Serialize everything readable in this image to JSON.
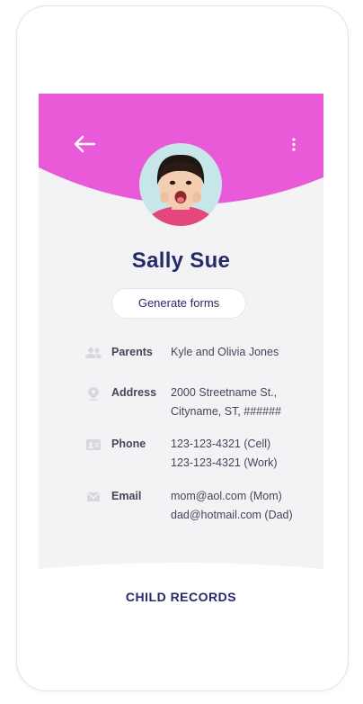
{
  "colors": {
    "accent": "#e95ad8",
    "navy": "#262a68",
    "background": "#f3f3f6",
    "icon": "#d7d8de"
  },
  "header": {
    "back_icon": "arrow-left-icon",
    "menu_icon": "more-vertical-icon"
  },
  "profile": {
    "name": "Sally Sue",
    "avatar": "child-photo"
  },
  "actions": {
    "generate_forms_label": "Generate forms"
  },
  "details": {
    "parents": {
      "label": "Parents",
      "icon": "people-icon",
      "lines": [
        "Kyle and Olivia Jones"
      ]
    },
    "address": {
      "label": "Address",
      "icon": "location-pin-icon",
      "lines": [
        "2000 Streetname St.,",
        "Cityname, ST, ######"
      ]
    },
    "phone": {
      "label": "Phone",
      "icon": "contact-card-icon",
      "lines": [
        "123-123-4321 (Cell)",
        "123-123-4321 (Work)"
      ]
    },
    "email": {
      "label": "Email",
      "icon": "mail-icon",
      "lines": [
        "mom@aol.com (Mom)",
        "dad@hotmail.com (Dad)"
      ]
    }
  },
  "records": {
    "title": "CHILD RECORDS"
  }
}
